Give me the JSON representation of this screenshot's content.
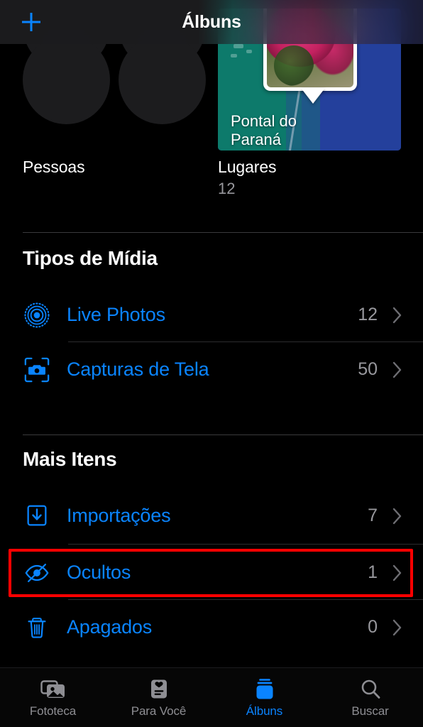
{
  "header": {
    "title": "Álbuns",
    "add_icon": "plus-icon",
    "accent_color": "#0a84ff"
  },
  "albums_grid": [
    {
      "name": "people",
      "title": "Pessoas",
      "count": "",
      "icon": "people-faces-thumbnail"
    },
    {
      "name": "places",
      "title": "Lugares",
      "count": "12",
      "icon": "map-thumbnail",
      "map_label": "Pontal do\nParaná"
    }
  ],
  "sections": [
    {
      "heading": "Tipos de Mídia",
      "rows": [
        {
          "label": "Live Photos",
          "count": "12",
          "icon": "live-photos-icon"
        },
        {
          "label": "Capturas de Tela",
          "count": "50",
          "icon": "screenshot-icon"
        }
      ]
    },
    {
      "heading": "Mais Itens",
      "rows": [
        {
          "label": "Importações",
          "count": "7",
          "icon": "import-tray-icon"
        },
        {
          "label": "Ocultos",
          "count": "1",
          "icon": "eye-slash-icon"
        },
        {
          "label": "Apagados",
          "count": "0",
          "icon": "trash-icon"
        }
      ]
    }
  ],
  "highlight": {
    "target_label": "Ocultos",
    "color": "#ff0000"
  },
  "tabbar": [
    {
      "label": "Fototeca",
      "icon": "photos-stack-icon",
      "active": false
    },
    {
      "label": "Para Você",
      "icon": "for-you-card-icon",
      "active": false
    },
    {
      "label": "Álbuns",
      "icon": "albums-icon",
      "active": true
    },
    {
      "label": "Buscar",
      "icon": "search-icon",
      "active": false
    }
  ],
  "colors": {
    "accent": "#0a84ff",
    "secondary_text": "#98989d",
    "background": "#000000",
    "highlight": "#ff0000"
  }
}
